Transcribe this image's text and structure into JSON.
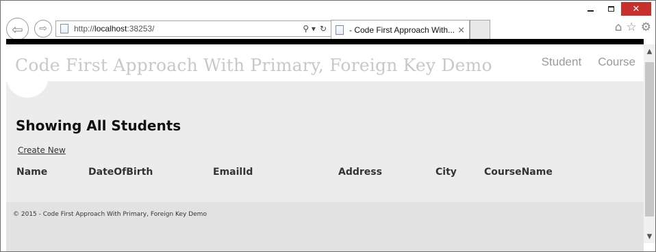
{
  "browser": {
    "url_prefix": "http://",
    "url_host": "localhost",
    "url_rest": ":38253/",
    "tab_title": "- Code First Approach With...",
    "tab_close": "×",
    "window_controls": {
      "close": "✕"
    }
  },
  "site": {
    "title": "Code First Approach With Primary, Foreign Key Demo",
    "menu": [
      {
        "label": "Student"
      },
      {
        "label": "Course"
      }
    ]
  },
  "main": {
    "heading": "Showing All Students",
    "create_new": "Create New",
    "columns": [
      "Name",
      "DateOfBirth",
      "EmailId",
      "Address",
      "City",
      "CourseName"
    ]
  },
  "footer": {
    "text": "© 2015 - Code First Approach With Primary, Foreign Key Demo"
  },
  "colors": {
    "title_gray": "#c8c8c8",
    "page_bg": "#ececec",
    "footer_bg": "#e2e2e2"
  }
}
